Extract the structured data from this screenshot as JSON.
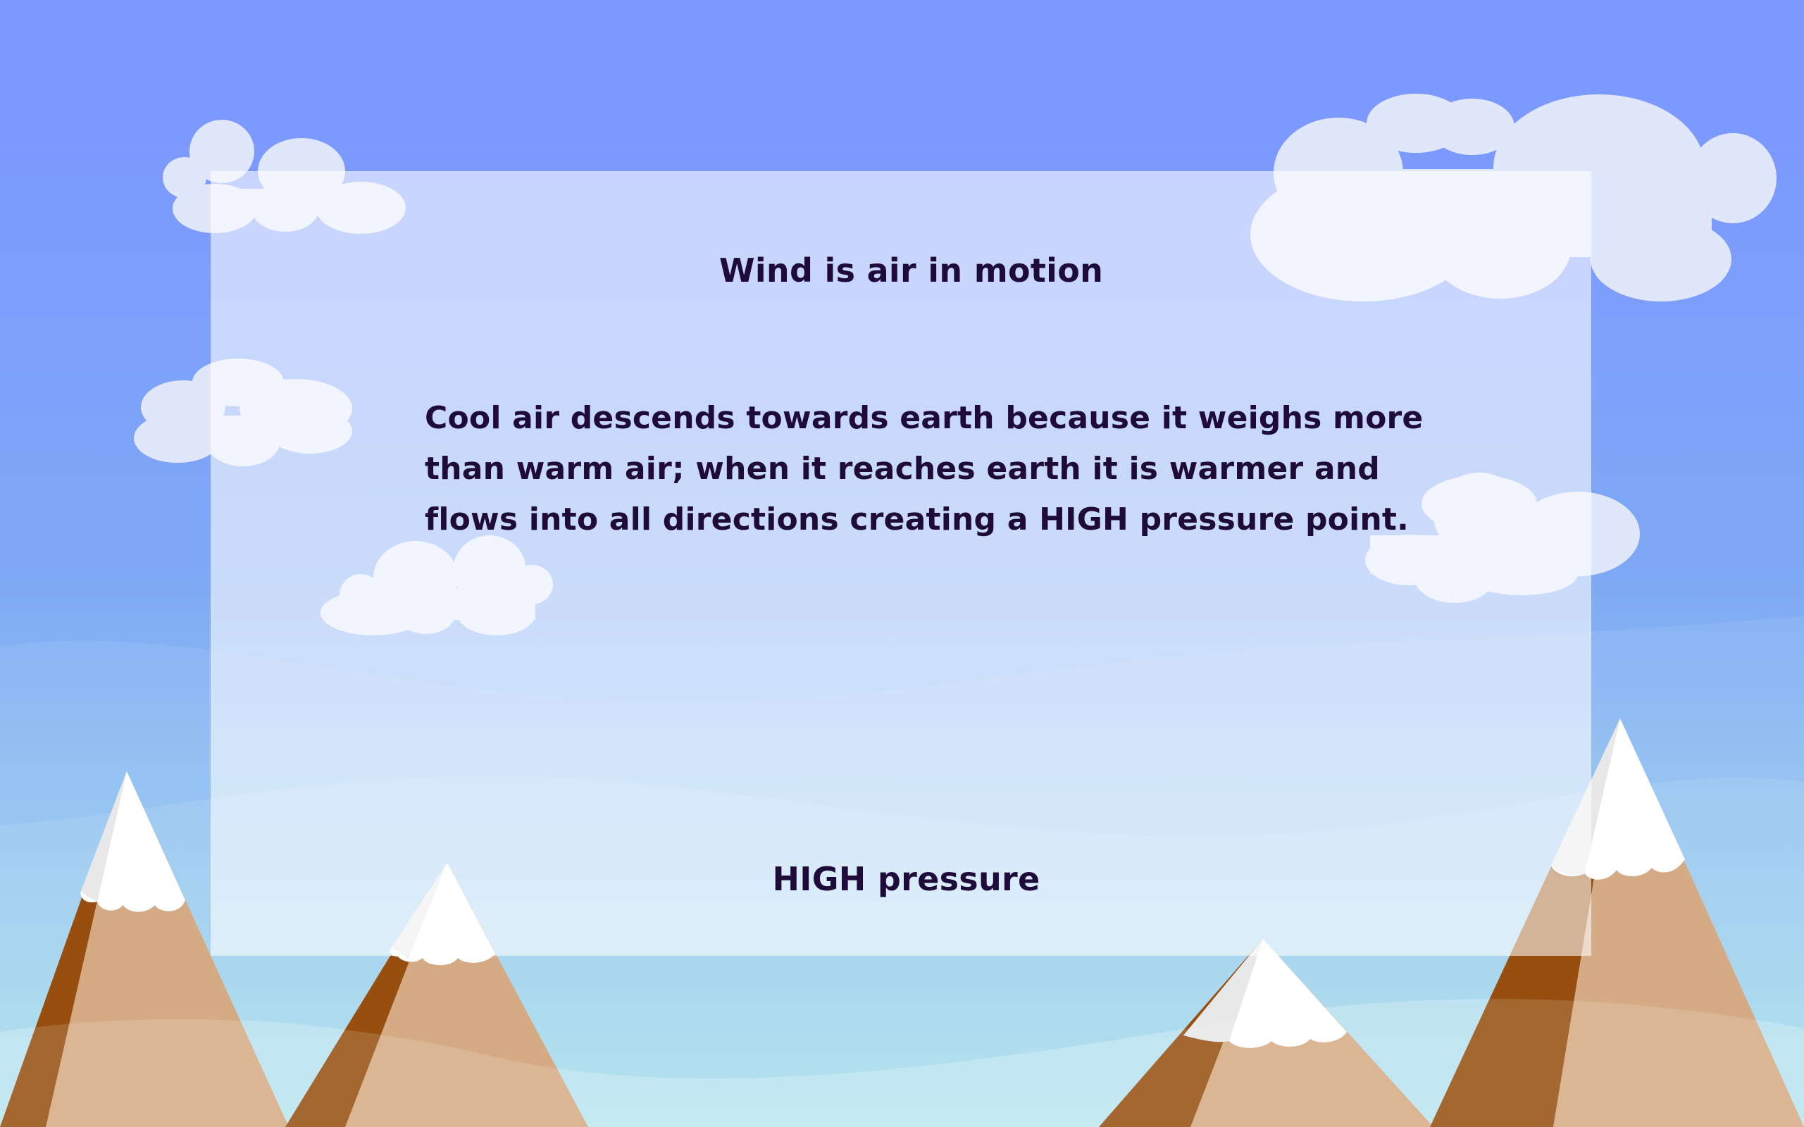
{
  "slide": {
    "title": "Wind is air in motion",
    "body": "Cool air descends towards earth because it weighs more than warm air; when it reaches earth it is warmer and flows into all directions creating a HIGH pressure point.",
    "label": "HIGH pressure"
  },
  "colors": {
    "sky_top": "#7c99ff",
    "sky_bottom": "#a4e0ea",
    "cloud": "#e0e7fb",
    "panel": "#ffffff",
    "text": "#1e0b3a",
    "mountain_light": "#d4ab84",
    "mountain_dark": "#974e0e",
    "snow": "#ffffff"
  },
  "icons": [
    "cloud-icon",
    "mountain-icon"
  ]
}
